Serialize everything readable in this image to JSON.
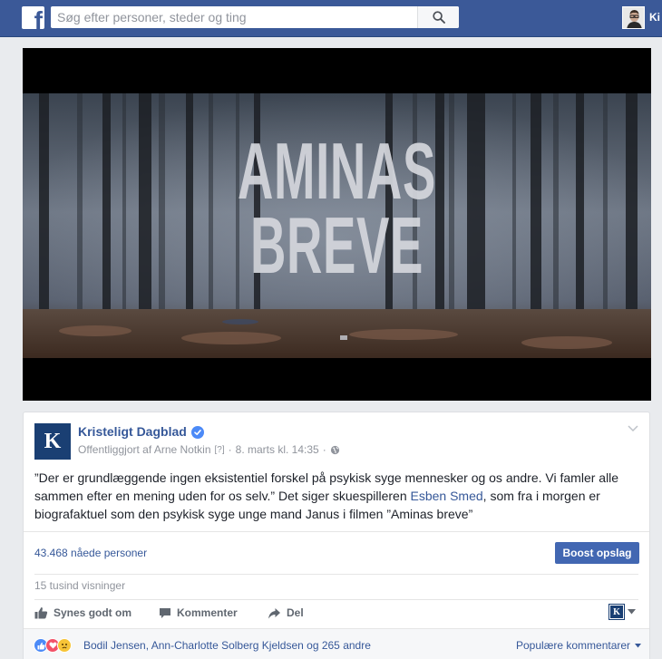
{
  "topbar": {
    "search_placeholder": "Søg efter personer, steder og ting",
    "user_name": "Ki"
  },
  "video": {
    "title_line1": "AMINAS",
    "title_line2": "BREVE"
  },
  "post": {
    "page_name": "Kristeligt Dagblad",
    "page_logo_letter": "K",
    "published_by": "Offentliggjort af Arne Notkin",
    "published_by_marker": "[?]",
    "date": "8. marts kl. 14:35",
    "text_before_mention": "”Der er grundlæggende ingen eksistentiel forskel på psykisk syge mennesker og os andre. Vi famler alle sammen efter en mening uden for os selv.” Det siger skuespilleren ",
    "mention": "Esben Smed",
    "text_after_mention": ", som fra i morgen er biografaktuel som den psykisk syge unge mand Janus i filmen ”Aminas breve”",
    "reach": "43.468 nåede personer",
    "boost_label": "Boost opslag",
    "views": "15 tusind visninger"
  },
  "actions": {
    "like": "Synes godt om",
    "comment": "Kommenter",
    "share": "Del"
  },
  "reactions": {
    "names": "Bodil Jensen, Ann-Charlotte Solberg Kjeldsen og 265 andre",
    "sort_label": "Populære kommentarer"
  },
  "colors": {
    "brand": "#3b5998",
    "link": "#365899",
    "button": "#4267b2",
    "page_logo": "#1a3f73"
  }
}
